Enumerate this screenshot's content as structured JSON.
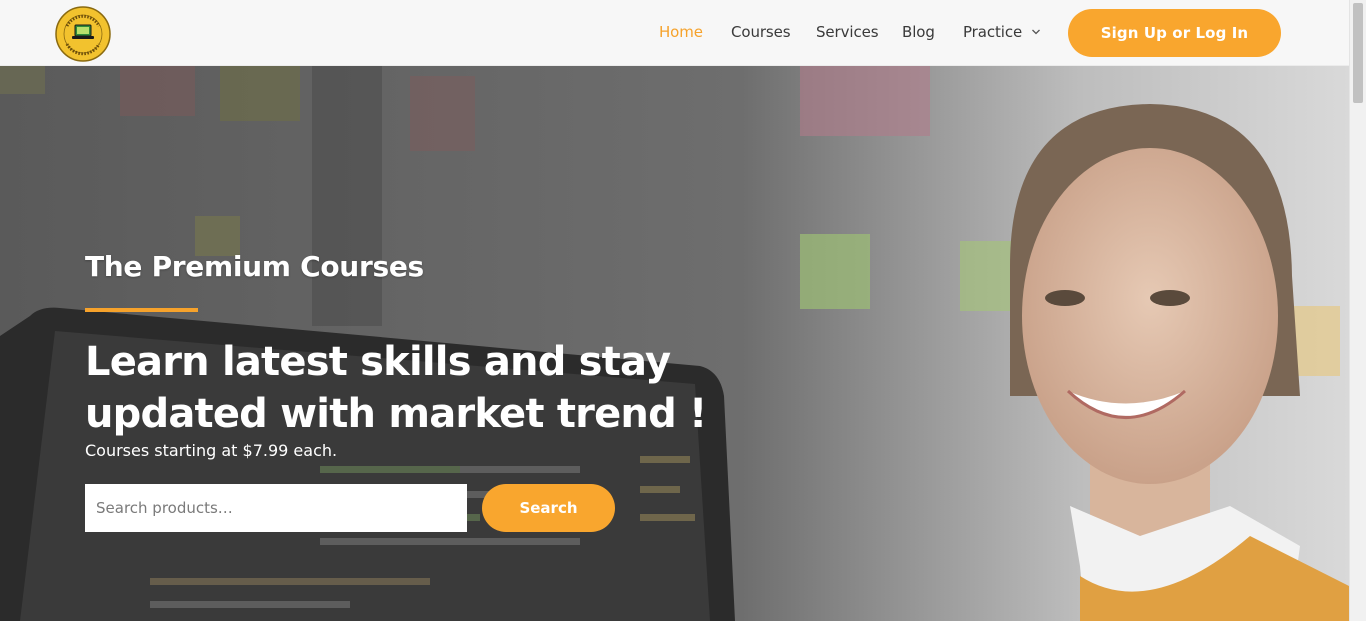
{
  "header": {
    "logo_text_top": "LET'S KODE IT",
    "logo_text_bottom": "Anyone Can Code",
    "nav": {
      "home": "Home",
      "courses": "Courses",
      "services": "Services",
      "blog": "Blog",
      "practice": "Practice"
    },
    "signup_label": "Sign Up or Log In"
  },
  "hero": {
    "eyebrow": "The Premium Courses",
    "heading": "Learn latest skills and stay updated with market trend !",
    "subtext": "Courses starting at $7.99 each.",
    "search": {
      "placeholder": "Search products…",
      "value": "",
      "button_label": "Search"
    }
  },
  "icons": {
    "logo": "laptop-badge-logo",
    "practice_dropdown": "chevron-down-icon"
  },
  "colors": {
    "accent": "#f6a22b",
    "button": "#f9a62e",
    "header_bg": "#f7f7f7",
    "nav_text": "#3a3a3a"
  }
}
